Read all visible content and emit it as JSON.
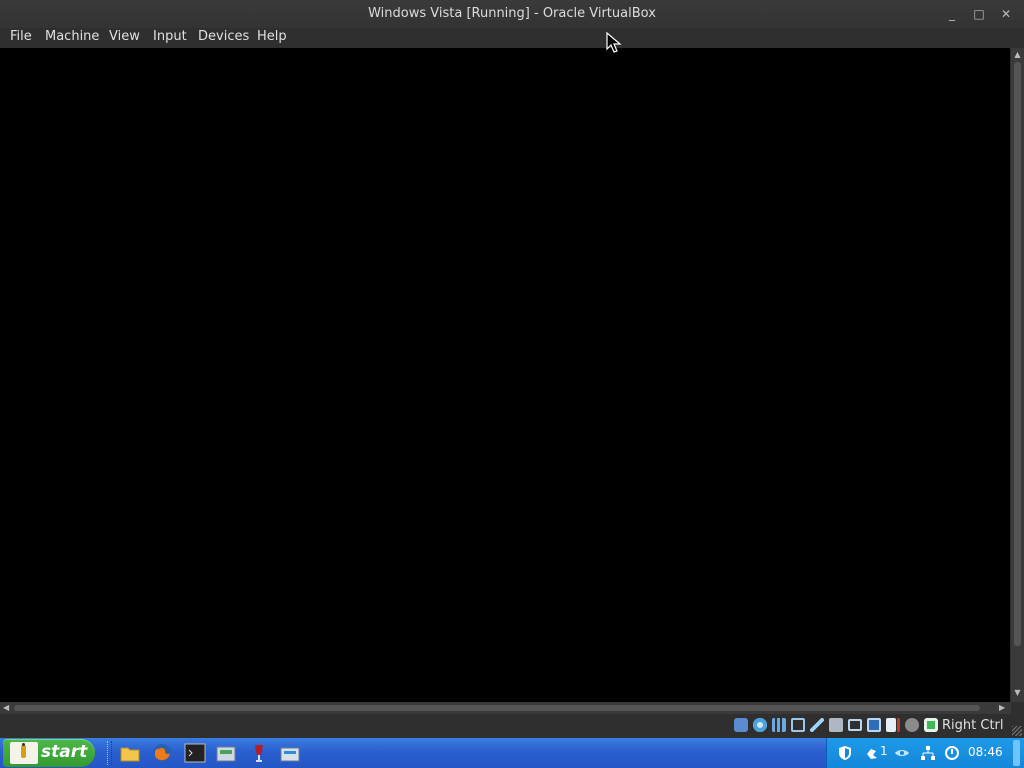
{
  "window": {
    "title": "Windows Vista [Running] - Oracle VirtualBox",
    "controls": {
      "minimize": "_",
      "maximize": "□",
      "close": "✕"
    }
  },
  "menubar": {
    "items": [
      {
        "label": "File"
      },
      {
        "label": "Machine"
      },
      {
        "label": "View"
      },
      {
        "label": "Input"
      },
      {
        "label": "Devices"
      },
      {
        "label": "Help"
      }
    ]
  },
  "statusbar": {
    "icons": [
      "hard-disk-icon",
      "optical-drive-icon",
      "audio-icon",
      "network-icon",
      "usb-icon",
      "shared-folders-icon",
      "display-icon",
      "recording-icon",
      "virtualization-icon",
      "mouse-integration-icon",
      "keyboard-capture-icon"
    ],
    "host_key": "Right Ctrl"
  },
  "guest_taskbar": {
    "start_label": "start",
    "quick_launch": [
      "folder-icon",
      "firefox-icon",
      "terminal-icon",
      "disk-manager-icon",
      "wine-icon",
      "installer-icon"
    ],
    "tray": {
      "icons": [
        "shield-icon",
        "notification-icon",
        "network-eye-icon",
        "lan-icon",
        "volume-icon"
      ],
      "notification_count": "1",
      "clock": "08:46"
    }
  },
  "colors": {
    "titlebar": "#333333",
    "vm_screen": "#000000",
    "taskbar_blue": "#2a5fcf",
    "start_green": "#3aa836",
    "tray_blue": "#1a8fe0"
  }
}
